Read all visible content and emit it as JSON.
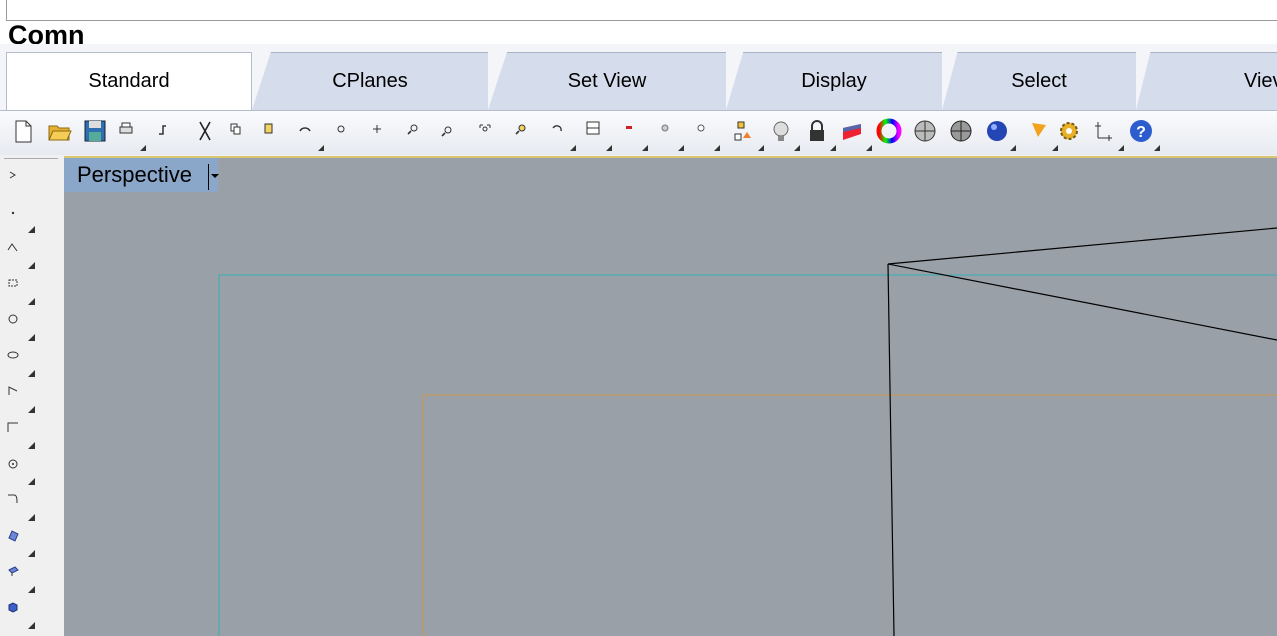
{
  "command": {
    "prompt": "Comn"
  },
  "tabs": [
    "Standard",
    "CPlanes",
    "Set View",
    "Display",
    "Select",
    "Viev"
  ],
  "active_tab": "Standard",
  "toolbar": {
    "icons": [
      "new-icon",
      "open-icon",
      "save-icon",
      "print-icon",
      "import-icon",
      "cut-icon",
      "copy-icon",
      "paste-icon",
      "undo-icon",
      "pan-icon",
      "rotate-view-icon",
      "zoom-icon",
      "zoom-window-icon",
      "zoom-extents-icon",
      "zoom-selected-icon",
      "undo-view-icon",
      "four-viewports-icon",
      "layer-icon",
      "hide-icon",
      "lock-icon",
      "properties-icon",
      "layers-icon",
      "color-icon",
      "wireframe-icon",
      "shaded-icon",
      "rendered-icon",
      "render-icon",
      "light-icon",
      "options-icon",
      "dimension-icon",
      "help-icon"
    ]
  },
  "sidebar": {
    "icons": [
      "select-icon",
      "point-icon",
      "polyline-icon",
      "rectangle-icon",
      "circle-icon",
      "ellipse-icon",
      "arc-icon",
      "fillet-icon",
      "circle-point-icon",
      "curve-icon",
      "surface-icon",
      "extrude-icon",
      "box-icon"
    ]
  },
  "viewport": {
    "label": "Perspective"
  },
  "colors": {
    "viewport_bg": "#9aa0a8",
    "label_bg": "#8aa6c9",
    "grid_cyan": "#31b0b5",
    "grid_orange": "#c8964a"
  }
}
